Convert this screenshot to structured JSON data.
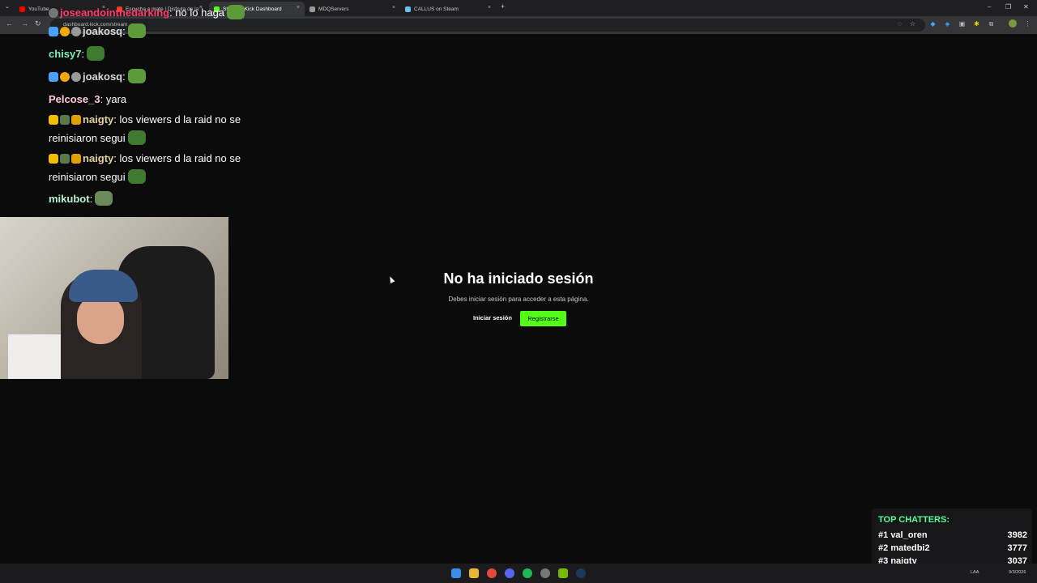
{
  "browser": {
    "tabs": [
      {
        "label": "YouTube",
        "color": "#ff0000"
      },
      {
        "label": "Escucha a mate | Disfruta de la",
        "color": "#e8451e"
      },
      {
        "label": "Stream - Kick Dashboard",
        "color": "#53fc18"
      },
      {
        "label": "MDQServers",
        "color": "#9a9a9a"
      },
      {
        "label": "CALLUS on Steam",
        "color": "#66c0f4"
      }
    ],
    "new_tab": "+",
    "url": "dashboard.kick.com/stream"
  },
  "chat": {
    "messages": [
      {
        "user": "joseandointhedarking",
        "user_color": "#ff3b6b",
        "text": ": no lo haga"
      },
      {
        "user": "joakosq",
        "user_color": "#d9d9d9",
        "text": ":"
      },
      {
        "user": "chisy7",
        "user_color": "#7ff2b3",
        "text": ":"
      },
      {
        "user": "joakosq",
        "user_color": "#d9d9d9",
        "text": ":"
      },
      {
        "user": "Pelcose_3",
        "user_color": "#ffc9d6",
        "text": ": yara"
      },
      {
        "user": "naigty",
        "user_color": "#e3d29a",
        "text": ": los viewers d la raid no se",
        "text2": "reinisiaron segui"
      },
      {
        "user": "naigty",
        "user_color": "#e3d29a",
        "text": ": los viewers d la raid no se",
        "text2": "reinisiaron segui"
      },
      {
        "user": "mikubot",
        "user_color": "#b8f0d0",
        "text": ":"
      }
    ]
  },
  "main": {
    "title": "No ha iniciado sesión",
    "subtitle": "Debes iniciar sesión para acceder a esta página.",
    "login_label": "Iniciar sesión",
    "register_label": "Registrarse",
    "accent": "#53fc18"
  },
  "top_chatters": {
    "title": "TOP CHATTERS:",
    "rows": [
      {
        "rank": "#1",
        "name": "val_oren",
        "score": "3982"
      },
      {
        "rank": "#2",
        "name": "matedbi2",
        "score": "3777"
      },
      {
        "rank": "#3",
        "name": "naigty",
        "score": "3037"
      }
    ]
  },
  "taskbar": {
    "tray_lang": "LAA",
    "tray_date": "9/3/2026"
  }
}
